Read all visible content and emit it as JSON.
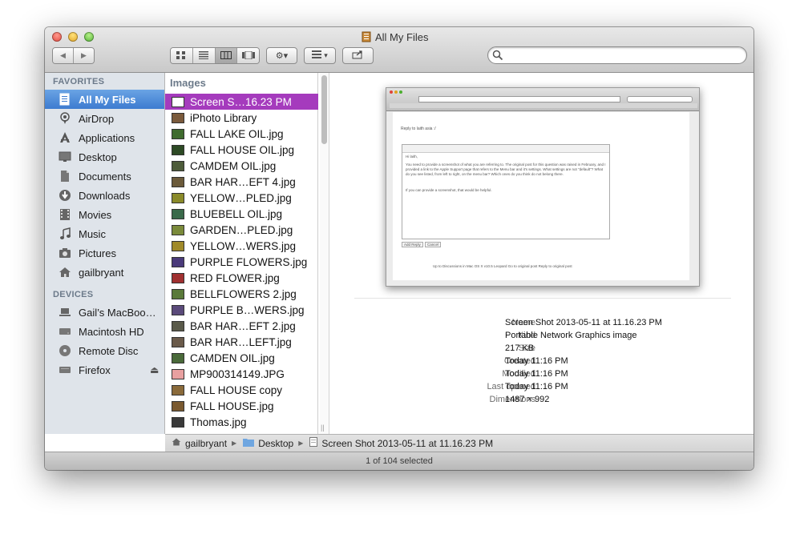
{
  "window": {
    "title": "All My Files"
  },
  "toolbar": {
    "back_glyph": "◀",
    "forward_glyph": "▶",
    "view_modes": [
      "icon-view",
      "list-view",
      "column-view",
      "coverflow-view"
    ],
    "active_view": "column-view",
    "action_glyph": "⚙▾",
    "arrange_glyph": "▾",
    "search_placeholder": ""
  },
  "sidebar": {
    "favorites_heading": "FAVORITES",
    "devices_heading": "DEVICES",
    "favorites": [
      {
        "label": "All My Files",
        "icon": "all-files-icon",
        "selected": true
      },
      {
        "label": "AirDrop",
        "icon": "airdrop-icon"
      },
      {
        "label": "Applications",
        "icon": "applications-icon"
      },
      {
        "label": "Desktop",
        "icon": "desktop-icon"
      },
      {
        "label": "Documents",
        "icon": "documents-icon"
      },
      {
        "label": "Downloads",
        "icon": "downloads-icon"
      },
      {
        "label": "Movies",
        "icon": "movies-icon"
      },
      {
        "label": "Music",
        "icon": "music-icon"
      },
      {
        "label": "Pictures",
        "icon": "pictures-icon"
      },
      {
        "label": "gailbryant",
        "icon": "home-icon"
      }
    ],
    "devices": [
      {
        "label": "Gail’s MacBoo…",
        "icon": "laptop-icon"
      },
      {
        "label": "Macintosh HD",
        "icon": "hard-drive-icon"
      },
      {
        "label": "Remote Disc",
        "icon": "disc-icon"
      },
      {
        "label": "Firefox",
        "icon": "drive-icon",
        "eject": "⏏"
      }
    ]
  },
  "column": {
    "heading": "Images",
    "files": [
      {
        "name": "Screen S…16.23 PM",
        "thumb": "#ffffff",
        "selected": true
      },
      {
        "name": "iPhoto Library",
        "thumb": "#7a5a3c"
      },
      {
        "name": "FALL LAKE OIL.jpg",
        "thumb": "#3f6b2e"
      },
      {
        "name": "FALL HOUSE OIL.jpg",
        "thumb": "#2d4a25"
      },
      {
        "name": "CAMDEM OIL.jpg",
        "thumb": "#4e5c3a"
      },
      {
        "name": "BAR HAR…EFT 4.jpg",
        "thumb": "#6b5a3a"
      },
      {
        "name": "YELLOW…PLED.jpg",
        "thumb": "#8a8a2a"
      },
      {
        "name": "BLUEBELL OIL.jpg",
        "thumb": "#3a6a4a"
      },
      {
        "name": "GARDEN…PLED.jpg",
        "thumb": "#7a8a3a"
      },
      {
        "name": "YELLOW…WERS.jpg",
        "thumb": "#a08a2a"
      },
      {
        "name": "PURPLE FLOWERS.jpg",
        "thumb": "#4a3a7a"
      },
      {
        "name": "RED FLOWER.jpg",
        "thumb": "#a03030"
      },
      {
        "name": "BELLFLOWERS 2.jpg",
        "thumb": "#5a7a3a"
      },
      {
        "name": "PURPLE B…WERS.jpg",
        "thumb": "#5a4a7a"
      },
      {
        "name": "BAR HAR…EFT 2.jpg",
        "thumb": "#5a5a4a"
      },
      {
        "name": "BAR HAR…LEFT.jpg",
        "thumb": "#6a5a4a"
      },
      {
        "name": "CAMDEN OIL.jpg",
        "thumb": "#4a6a3a"
      },
      {
        "name": "MP900314149.JPG",
        "thumb": "#e8a0a0"
      },
      {
        "name": "FALL HOUSE copy",
        "thumb": "#8a6a3a"
      },
      {
        "name": "FALL HOUSE.jpg",
        "thumb": "#7a5a30"
      },
      {
        "name": "Thomas.jpg",
        "thumb": "#3a3a3a"
      }
    ]
  },
  "preview": {
    "thumb_text": {
      "reply_to": "Reply to laith asia :/",
      "greeting": "Hi laith,",
      "body": "You need to provide a screenshot of what you are referring to. The original post for this question was raised in February, and I provided a link to the Apple Support page that refers to the Menu bar and it's settings. What settings are not \"default\"? What do you see listed, from left to right, on the menu bar? Which ones do you think do not belong there.",
      "closing": "If you can provide a screenshot, that would be helpful.",
      "add_reply": "Add Reply",
      "cancel": "Cancel",
      "footer": "Up to Discussions in Mac OS X v10.5 Leopard   Go to original post   Reply to original post"
    },
    "meta": [
      {
        "key": "Name",
        "value": "Screen Shot 2013-05-11 at 11.16.23 PM"
      },
      {
        "key": "Kind",
        "value": "Portable Network Graphics image"
      },
      {
        "key": "Size",
        "value": "217 KB"
      },
      {
        "key": "Created",
        "value": "Today 11:16 PM"
      },
      {
        "key": "Modified",
        "value": "Today 11:16 PM"
      },
      {
        "key": "Last opened",
        "value": "Today 11:16 PM"
      },
      {
        "key": "Dimensions",
        "value": "1487 × 992"
      }
    ]
  },
  "pathbar": {
    "items": [
      {
        "label": "gailbryant",
        "icon": "home-icon"
      },
      {
        "label": "Desktop",
        "icon": "folder-icon"
      },
      {
        "label": "Screen Shot 2013-05-11 at 11.16.23 PM",
        "icon": "file-icon"
      }
    ],
    "separator": "▶"
  },
  "status": {
    "text": "1 of 104 selected"
  },
  "colors": {
    "selection_purple": "#a53bbd",
    "sidebar_selection_blue": "#4a89d6",
    "sidebar_bg": "#dfe4ea"
  }
}
